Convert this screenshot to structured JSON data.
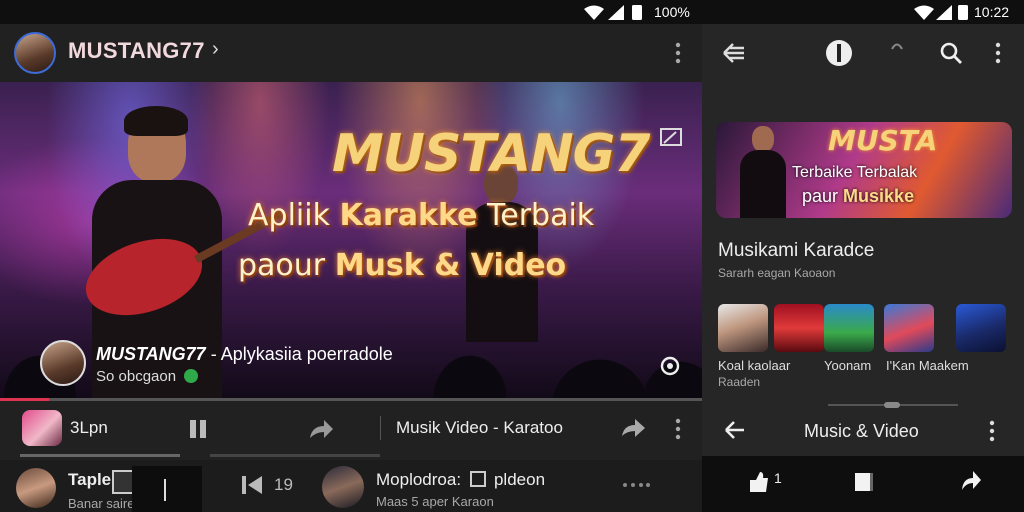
{
  "left_status": {
    "battery": "100%"
  },
  "right_status": {
    "time": "10:22"
  },
  "channel": {
    "name": "MUSTANG77",
    "chevron": "›"
  },
  "hero": {
    "title": "MUSTANG7",
    "line1_a": "Apliik",
    "line1_b": "Karakke",
    "line1_c": "Terbaik",
    "line2_a": "paour",
    "line2_b": "Musk & Video",
    "overlay_name": "MUSTANG77",
    "overlay_desc": "- Aplykasiia poerradole",
    "overlay_sub": "So obcgaon"
  },
  "playback": {
    "progress": 0.07
  },
  "now_playing": {
    "label": "3Lpn",
    "title": "Musik Video - Karatoo"
  },
  "bottom_left": {
    "item1_title": "Taple",
    "item1_sub": "Banar saire",
    "skip_count": "19",
    "item2_title": "Moplodroa:",
    "item2_tag": "pldeon",
    "item2_sub": "Maas 5 aper Karaon"
  },
  "right": {
    "banner_title": "MUSTA",
    "banner_line1": "Terbaike Terbalak",
    "banner_line2_a": "paur",
    "banner_line2_b": "Musikke",
    "section_title": "Musikami Karadce",
    "section_sub": "Sararh eagan Kaoaon",
    "thumbs": [
      {
        "label": "Koal kaolaar"
      },
      {
        "label": "Yoonam"
      },
      {
        "label": "I'Kan Maakem"
      },
      {
        "label": "Raaden"
      }
    ],
    "nav_title": "Music & Video",
    "bottom_count": "1"
  },
  "colors": {
    "accent": "#e0334f",
    "hero_title": "#f6d37a",
    "background": "#212121"
  }
}
